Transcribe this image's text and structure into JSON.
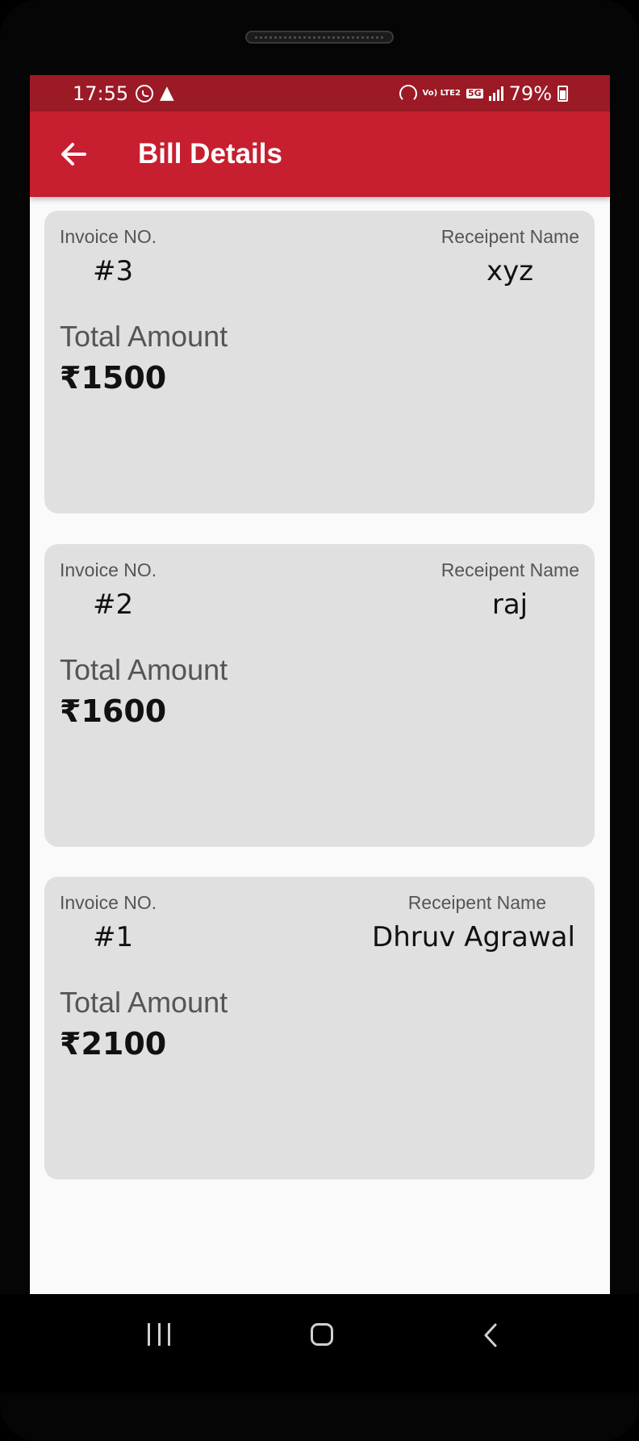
{
  "status_bar": {
    "time": "17:55",
    "volte_label": "Vo) LTE2",
    "network_label": "5G",
    "battery": "79%"
  },
  "app_bar": {
    "title": "Bill Details"
  },
  "bills": [
    {
      "invoice_label": "Invoice NO.",
      "invoice_no": "#3",
      "recipient_label": "Receipent Name",
      "recipient": "xyz",
      "total_label": "Total Amount",
      "total": "₹1500"
    },
    {
      "invoice_label": "Invoice NO.",
      "invoice_no": "#2",
      "recipient_label": "Receipent Name",
      "recipient": "raj",
      "total_label": "Total Amount",
      "total": "₹1600"
    },
    {
      "invoice_label": "Invoice NO.",
      "invoice_no": "#1",
      "recipient_label": "Receipent Name",
      "recipient": "Dhruv Agrawal",
      "total_label": "Total Amount",
      "total": "₹2100"
    }
  ],
  "colors": {
    "status_bar": "#9b1a26",
    "app_bar": "#c71f30",
    "card": "#e0e0e0",
    "background": "#fafafa"
  }
}
